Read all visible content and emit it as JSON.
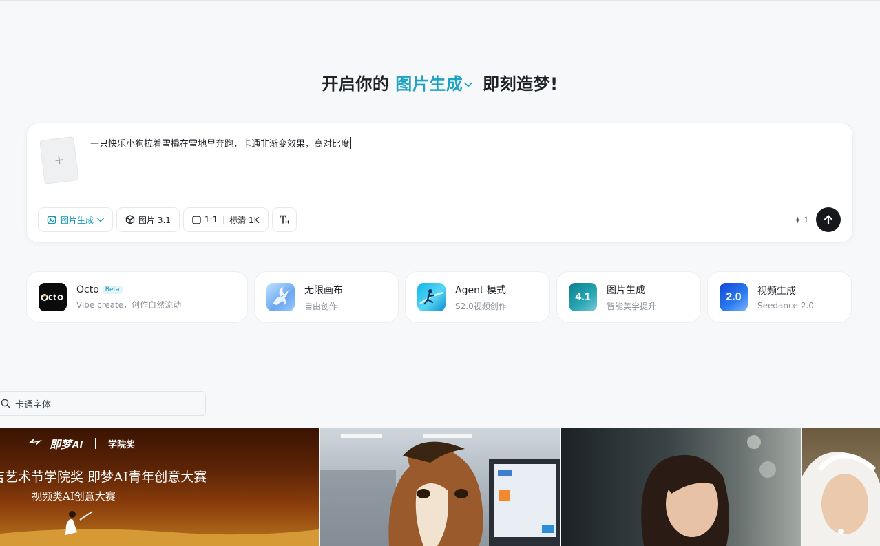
{
  "hero": {
    "prefix": "开启你的",
    "mode": "图片生成",
    "suffix": "即刻造梦!"
  },
  "prompt": {
    "upload_symbol": "+",
    "text": "一只快乐小狗拉着雪橇在雪地里奔跑，卡通非渐变效果，高对比度"
  },
  "toolbar": {
    "mode_label": "图片生成",
    "model_label": "图片 3.1",
    "ratio_label": "1:1",
    "quality_label": "标清 1K",
    "credits": "1"
  },
  "features": [
    {
      "title": "Octo",
      "badge": "Beta",
      "subtitle": "Vibe create，创作自然流动"
    },
    {
      "title": "无限画布",
      "subtitle": "自由创作"
    },
    {
      "title": "Agent 模式",
      "subtitle": "S2.0视频创作"
    },
    {
      "title": "图片生成",
      "subtitle": "智能美学提升",
      "icon_text": "4.1"
    },
    {
      "title": "视频生成",
      "subtitle": "Seedance 2.0",
      "icon_text": "2.0"
    }
  ],
  "search": {
    "value": "卡通字体"
  },
  "gallery": {
    "banner": {
      "brand": "即梦AI",
      "award": "学院奖",
      "line1": "吉艺术节学院奖 即梦AI青年创意大赛",
      "line2": "视频类AI创意大赛"
    }
  },
  "colors": {
    "accent": "#1ea3c2",
    "send_button": "#16181c"
  },
  "icons": [
    "plus-icon",
    "image-sparkle-icon",
    "chevron-down-icon",
    "cube-icon",
    "square-ratio-icon",
    "text-size-icon",
    "sparkle-icon",
    "arrow-up-icon",
    "search-icon"
  ]
}
